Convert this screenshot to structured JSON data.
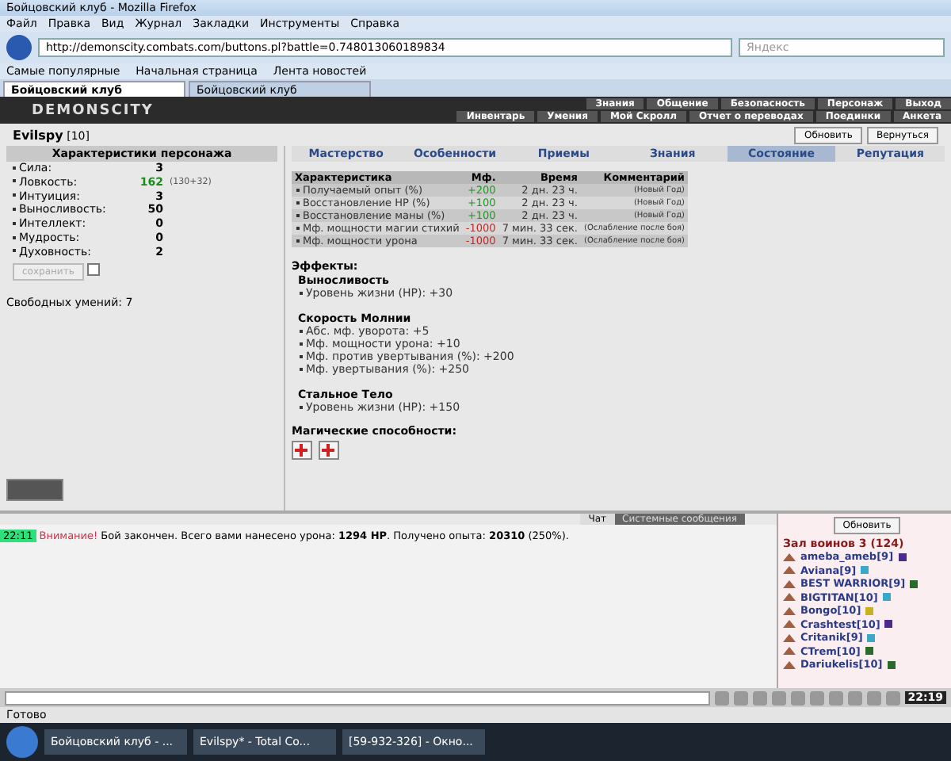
{
  "window": {
    "title": "Бойцовский клуб - Mozilla Firefox"
  },
  "menu": [
    "Файл",
    "Правка",
    "Вид",
    "Журнал",
    "Закладки",
    "Инструменты",
    "Справка"
  ],
  "address": {
    "value": "http://demonscity.combats.com/buttons.pl?battle=0.748013060189834"
  },
  "search": {
    "placeholder": "Яндекс"
  },
  "bookmarks": [
    "Самые популярные",
    "Начальная страница",
    "Лента новостей"
  ],
  "browser_tabs": [
    {
      "label": "Бойцовский клуб",
      "selected": true
    },
    {
      "label": "Бойцовский клуб",
      "selected": false
    }
  ],
  "game": {
    "logo": "DEMONSCITY",
    "top_menu": [
      "Знания",
      "Общение",
      "Безопасность",
      "Персонаж",
      "Выход"
    ],
    "sub_menu": [
      "Инвентарь",
      "Умения",
      "Мой Скролл",
      "Отчет о переводах",
      "Поединки",
      "Анкета"
    ]
  },
  "character": {
    "name": "Evilspy",
    "level": "[10]",
    "buttons": [
      "Обновить",
      "Вернуться"
    ]
  },
  "stats_panel": {
    "title": "Характеристики персонажа",
    "stats": [
      {
        "label": "Сила:",
        "value": "3",
        "boosted": false
      },
      {
        "label": "Ловкость:",
        "value": "162",
        "bonus": "(130+32)",
        "boosted": true
      },
      {
        "label": "Интуиция:",
        "value": "3",
        "boosted": false
      },
      {
        "label": "Выносливость:",
        "value": "50",
        "boosted": false
      },
      {
        "label": "Интеллект:",
        "value": "0",
        "boosted": false
      },
      {
        "label": "Мудрость:",
        "value": "0",
        "boosted": false
      },
      {
        "label": "Духовность:",
        "value": "2",
        "boosted": false
      }
    ],
    "save_button": {
      "label": "сохранить",
      "disabled": true
    },
    "save_checkbox": {
      "checked": false
    },
    "free_skills": "Свободных умений: 7"
  },
  "tabs": [
    {
      "label": "Мастерство",
      "selected": false
    },
    {
      "label": "Особенности",
      "selected": false
    },
    {
      "label": "Приемы",
      "selected": false
    },
    {
      "label": "Знания",
      "selected": false
    },
    {
      "label": "Состояние",
      "selected": true
    },
    {
      "label": "Репутация",
      "selected": false
    }
  ],
  "table": {
    "columns": [
      "Характеристика",
      "Мф.",
      "Время",
      "Комментарий"
    ],
    "rows": [
      {
        "name": "Получаемый опыт (%)",
        "mf": "+200",
        "kind": "positive",
        "time": "2 дн. 23 ч.",
        "comment": "(Новый Год)"
      },
      {
        "name": "Восстановление НР (%)",
        "mf": "+100",
        "kind": "positive",
        "time": "2 дн. 23 ч.",
        "comment": "(Новый Год)"
      },
      {
        "name": "Восстановление маны (%)",
        "mf": "+100",
        "kind": "positive",
        "time": "2 дн. 23 ч.",
        "comment": "(Новый Год)"
      },
      {
        "name": "Мф. мощности магии стихий",
        "mf": "-1000",
        "kind": "negative",
        "time": "7 мин. 33 сек.",
        "comment": "(Ослабление после боя)"
      },
      {
        "name": "Мф. мощности урона",
        "mf": "-1000",
        "kind": "negative",
        "time": "7 мин. 33 сек.",
        "comment": "(Ослабление после боя)"
      }
    ]
  },
  "effects": {
    "title": "Эффекты:",
    "groups": [
      {
        "name": "Выносливость",
        "items": [
          "Уровень жизни (HP): +30"
        ]
      },
      {
        "name": "Скорость Молнии",
        "items": [
          "Абс. мф. уворота: +5",
          "Мф. мощности урона: +10",
          "Мф. против увертывания (%): +200",
          "Мф. увертывания (%): +250"
        ]
      },
      {
        "name": "Стальное Тело",
        "items": [
          "Уровень жизни (HP): +150"
        ]
      }
    ]
  },
  "magic": {
    "title": "Магические способности:"
  },
  "chat": {
    "tabs": [
      {
        "label": "Чат",
        "selected": true
      },
      {
        "label": "Системные сообщения",
        "selected": false
      }
    ],
    "messages": [
      {
        "time": "22:11",
        "alert": "Внимание!",
        "text": "Бой закончен. Всего вами нанесено урона: **1294 HP**. Получено опыта: **20310** (250%)."
      }
    ]
  },
  "room": {
    "refresh": "Обновить",
    "title": "Зал воинов 3 (124)",
    "users": [
      {
        "name": "ameba_ameb",
        "level": "[9]",
        "color": "#4b2a8c"
      },
      {
        "name": "Aviana",
        "level": "[9]",
        "color": "#3aa8c8"
      },
      {
        "name": "BEST WARRIOR",
        "level": "[9]",
        "color": "#2a6a2a"
      },
      {
        "name": "BIGTITAN",
        "level": "[10]",
        "color": "#3aa8c8"
      },
      {
        "name": "Bongo",
        "level": "[10]",
        "color": "#c8b020"
      },
      {
        "name": "Crashtest",
        "level": "[10]",
        "color": "#4b2a8c"
      },
      {
        "name": "Critanik",
        "level": "[9]",
        "color": "#3aa8c8"
      },
      {
        "name": "CTrem",
        "level": "[10]",
        "color": "#2a6a2a"
      },
      {
        "name": "Dariukelis",
        "level": "[10]",
        "color": "#2a6a2a"
      }
    ]
  },
  "clock": "22:19",
  "status_bar": "Готово",
  "taskbar": [
    "Бойцовский клуб - ...",
    "Evilspy* - Total Co...",
    "[59-932-326] - Окно..."
  ]
}
